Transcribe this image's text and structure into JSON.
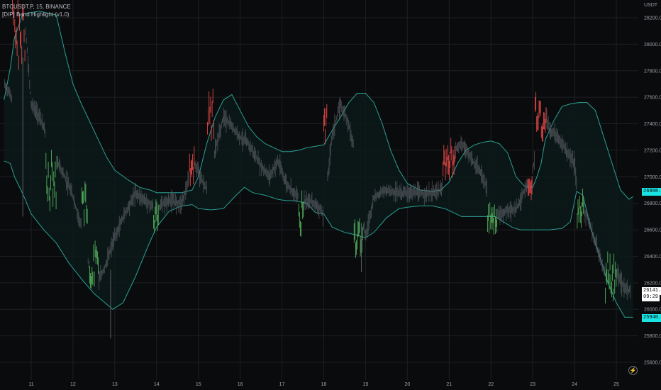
{
  "header": {
    "symbol_line": "BTCUSDT.P, 15, BINANCE",
    "indicator_line": "[DIP] Band Highlight (v1.0)"
  },
  "axis": {
    "currency_label": "USDT"
  },
  "price_tags": {
    "upper_band": "26888.1",
    "last_price": "26141.0",
    "countdown": "09:29",
    "lower_band": "25940.0"
  },
  "icons": {
    "settings": "lightning-icon"
  },
  "colors": {
    "background": "#0a0b0c",
    "band_line": "#2a9f94",
    "band_fill": "#0c1a1a",
    "candle_neutral": "#5b5f66",
    "candle_up_highlight": "#57b760",
    "candle_down_highlight": "#ee4b4b",
    "grid": "#1c1f24",
    "tag_cyan": "#19e3e3"
  },
  "chart_data": {
    "type": "line",
    "title": "BTCUSDT.P, 15, BINANCE",
    "xlabel": "",
    "ylabel": "USDT",
    "ylim": [
      25500,
      28300
    ],
    "xlim": [
      10.35,
      25.4
    ],
    "x_ticks": [
      11,
      12,
      13,
      14,
      15,
      16,
      17,
      18,
      19,
      20,
      21,
      22,
      23,
      24,
      25
    ],
    "x_tick_labels": [
      "11",
      "12",
      "13",
      "14",
      "15",
      "16",
      "17",
      "18",
      "19",
      "20",
      "21",
      "22",
      "23",
      "24",
      "25"
    ],
    "y_ticks": [
      25600,
      25800,
      26000,
      26200,
      26400,
      26600,
      26800,
      27000,
      27200,
      27400,
      27600,
      27800,
      28000,
      28200
    ],
    "y_tick_labels": [
      "25600.0",
      "25800.0",
      "26000.0",
      "26200.0",
      "26400.0",
      "26600.0",
      "26800.0",
      "27000.0",
      "27200.0",
      "27400.0",
      "27600.0",
      "27800.0",
      "28000.0",
      "28200.0"
    ],
    "grid": true,
    "series": [
      {
        "role": "price",
        "x": [
          10.35,
          10.5,
          10.65,
          10.75,
          10.85,
          11.0,
          11.2,
          11.5,
          11.8,
          12.0,
          12.2,
          12.4,
          12.6,
          12.8,
          12.95,
          13.2,
          13.5,
          13.8,
          14.0,
          14.3,
          14.6,
          14.75,
          14.9,
          15.05,
          15.2,
          15.4,
          15.6,
          15.8,
          16.0,
          16.2,
          16.5,
          16.7,
          16.9,
          17.1,
          17.3,
          17.5,
          17.7,
          17.9,
          18.0,
          18.2,
          18.4,
          18.6,
          18.8,
          18.9,
          19.0,
          19.2,
          19.5,
          19.8,
          20.0,
          20.2,
          20.5,
          20.8,
          20.95,
          21.1,
          21.3,
          21.5,
          21.8,
          22.0,
          22.2,
          22.4,
          22.6,
          22.8,
          23.0,
          23.1,
          23.25,
          23.4,
          23.6,
          23.8,
          24.0,
          24.1,
          24.3,
          24.5,
          24.7,
          24.9,
          25.0,
          25.2,
          25.35
        ],
        "y": [
          27700,
          27620,
          27480,
          27950,
          28180,
          27550,
          27450,
          27200,
          27000,
          26850,
          26620,
          26300,
          26200,
          26350,
          26500,
          26700,
          26880,
          26800,
          26760,
          26820,
          26800,
          26950,
          27100,
          27000,
          26900,
          27200,
          27450,
          27380,
          27300,
          27250,
          27080,
          27000,
          27120,
          26950,
          26880,
          26800,
          26820,
          26760,
          26700,
          27320,
          27550,
          27400,
          27100,
          26700,
          26550,
          26850,
          26900,
          26880,
          26880,
          26880,
          26870,
          26900,
          27000,
          27200,
          27250,
          27150,
          27000,
          26830,
          26700,
          26750,
          26750,
          26900,
          27050,
          27250,
          27550,
          27350,
          27300,
          27200,
          27100,
          26800,
          26700,
          26500,
          26300,
          26200,
          26280,
          26150,
          26141
        ]
      },
      {
        "role": "upper_band",
        "x": [
          10.35,
          10.5,
          10.6,
          10.8,
          11.2,
          11.6,
          11.8,
          12.0,
          12.2,
          12.5,
          12.8,
          13.0,
          13.3,
          13.6,
          13.85,
          14.0,
          14.3,
          14.6,
          14.85,
          15.0,
          15.2,
          15.4,
          15.6,
          15.8,
          16.0,
          16.2,
          16.4,
          16.6,
          16.8,
          17.0,
          17.2,
          17.4,
          17.6,
          17.8,
          18.0,
          18.2,
          18.4,
          18.6,
          18.8,
          19.0,
          19.2,
          19.4,
          19.6,
          19.8,
          20.0,
          20.3,
          20.6,
          20.8,
          21.0,
          21.2,
          21.4,
          21.6,
          21.8,
          22.0,
          22.2,
          22.4,
          22.6,
          22.8,
          23.0,
          23.1,
          23.2,
          23.3,
          23.5,
          23.7,
          23.9,
          24.1,
          24.3,
          24.5,
          24.7,
          24.9,
          25.1,
          25.3,
          25.4
        ],
        "y": [
          27580,
          27820,
          28050,
          28230,
          28250,
          28220,
          27950,
          27700,
          27550,
          27350,
          27150,
          27050,
          26980,
          26920,
          26900,
          26880,
          26880,
          26880,
          26900,
          27000,
          27250,
          27450,
          27580,
          27620,
          27500,
          27380,
          27300,
          27250,
          27220,
          27190,
          27190,
          27200,
          27220,
          27230,
          27240,
          27350,
          27450,
          27560,
          27630,
          27630,
          27560,
          27400,
          27200,
          27050,
          26950,
          26900,
          26890,
          26900,
          26960,
          27100,
          27200,
          27240,
          27260,
          27270,
          27250,
          27180,
          27000,
          26930,
          26920,
          27000,
          27100,
          27280,
          27420,
          27530,
          27550,
          27560,
          27560,
          27500,
          27300,
          27100,
          26900,
          26830,
          26850
        ]
      },
      {
        "role": "lower_band",
        "x": [
          10.35,
          10.5,
          10.6,
          10.8,
          11.0,
          11.3,
          11.6,
          11.9,
          12.2,
          12.5,
          12.8,
          12.95,
          13.2,
          13.5,
          13.8,
          14.0,
          14.3,
          14.6,
          14.85,
          15.0,
          15.3,
          15.6,
          15.9,
          16.1,
          16.3,
          16.6,
          16.9,
          17.1,
          17.3,
          17.6,
          17.8,
          18.0,
          18.2,
          18.5,
          18.8,
          19.0,
          19.2,
          19.5,
          19.8,
          20.0,
          20.3,
          20.6,
          20.9,
          21.1,
          21.3,
          21.6,
          21.9,
          22.1,
          22.3,
          22.5,
          22.7,
          22.9,
          23.1,
          23.4,
          23.7,
          23.9,
          24.05,
          24.2,
          24.4,
          24.6,
          24.8,
          25.0,
          25.2,
          25.4
        ],
        "y": [
          27120,
          27100,
          27000,
          26870,
          26720,
          26600,
          26500,
          26350,
          26230,
          26120,
          26040,
          26000,
          26050,
          26250,
          26480,
          26620,
          26740,
          26780,
          26790,
          26760,
          26750,
          26760,
          26860,
          26920,
          26880,
          26860,
          26830,
          26820,
          26820,
          26800,
          26730,
          26720,
          26620,
          26580,
          26560,
          26540,
          26580,
          26690,
          26760,
          26770,
          26780,
          26780,
          26760,
          26730,
          26700,
          26700,
          26700,
          26700,
          26660,
          26620,
          26600,
          26600,
          26600,
          26600,
          26610,
          26660,
          26890,
          26860,
          26600,
          26400,
          26200,
          26050,
          25940,
          25940
        ]
      }
    ],
    "highlights_up": [
      {
        "x": [
          11.35,
          11.62
        ],
        "low": 26780,
        "high": 27150
      },
      {
        "x": [
          12.2,
          12.35
        ],
        "low": 26680,
        "high": 26900
      },
      {
        "x": [
          12.38,
          12.62
        ],
        "low": 26200,
        "high": 26450
      },
      {
        "x": [
          13.92,
          14.05
        ],
        "low": 26620,
        "high": 26800
      },
      {
        "x": [
          17.4,
          17.52
        ],
        "low": 26600,
        "high": 26880
      },
      {
        "x": [
          18.72,
          18.95
        ],
        "low": 26450,
        "high": 26700
      },
      {
        "x": [
          21.9,
          22.15
        ],
        "low": 26600,
        "high": 26760
      },
      {
        "x": [
          24.05,
          24.22
        ],
        "low": 26650,
        "high": 26850
      },
      {
        "x": [
          24.72,
          25.0
        ],
        "low": 26100,
        "high": 26400
      }
    ],
    "highlights_down": [
      {
        "x": [
          10.55,
          10.85
        ],
        "low": 27850,
        "high": 28300
      },
      {
        "x": [
          14.78,
          14.9
        ],
        "low": 27000,
        "high": 27180
      },
      {
        "x": [
          15.2,
          15.38
        ],
        "low": 27300,
        "high": 27620
      },
      {
        "x": [
          17.98,
          18.08
        ],
        "low": 27300,
        "high": 27500
      },
      {
        "x": [
          20.85,
          21.15
        ],
        "low": 27030,
        "high": 27230
      },
      {
        "x": [
          22.88,
          23.0
        ],
        "low": 26900,
        "high": 27050
      },
      {
        "x": [
          23.05,
          23.32
        ],
        "low": 27320,
        "high": 27600
      }
    ]
  }
}
